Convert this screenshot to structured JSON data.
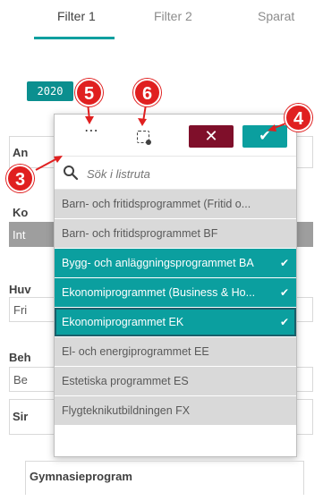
{
  "tabs": [
    {
      "label": "Filter 1",
      "active": true
    },
    {
      "label": "Filter 2",
      "active": false
    },
    {
      "label": "Sparat",
      "active": false
    }
  ],
  "year_chip": "2020",
  "background": {
    "box1_label": "An",
    "box2_label": "Ko",
    "box2_value": "Int",
    "box3_label": "Huv",
    "box3_value": "Fri",
    "box4_label": "Beh",
    "box4_value": "Be",
    "box5_label": "Sir",
    "bottom_label": "Gymnasieprogram"
  },
  "toolbar": {
    "more_icon": "ellipsis-icon",
    "lasso_icon": "lasso-select-icon",
    "cancel_symbol": "✕",
    "confirm_symbol": "✔"
  },
  "search": {
    "placeholder": "Sök i listruta"
  },
  "list_items": [
    {
      "label": "Barn- och fritidsprogrammet (Fritid o...",
      "state": "grey"
    },
    {
      "label": "Barn- och fritidsprogrammet BF",
      "state": "grey"
    },
    {
      "label": "Bygg- och anläggningsprogrammet BA",
      "state": "selected"
    },
    {
      "label": "Ekonomiprogrammet (Business & Ho...",
      "state": "selected"
    },
    {
      "label": "Ekonomiprogrammet EK",
      "state": "selected-focus"
    },
    {
      "label": "El- och energiprogrammet EE",
      "state": "grey"
    },
    {
      "label": "Estetiska programmet ES",
      "state": "grey"
    },
    {
      "label": "Flygteknikutbildningen FX",
      "state": "grey"
    }
  ],
  "check_symbol": "✔",
  "badges": [
    "3",
    "4",
    "5",
    "6"
  ],
  "colors": {
    "accent": "#0b9f9f",
    "cancel": "#7f0f2a",
    "badge": "#e02020",
    "excluded": "#d9d9d9"
  }
}
